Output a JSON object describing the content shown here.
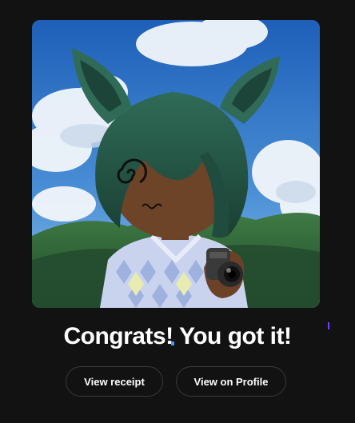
{
  "result": {
    "title": "Congrats! You got it!"
  },
  "artwork": {
    "icon": "nft-avatar-image"
  },
  "actions": {
    "receipt_label": "View receipt",
    "profile_label": "View on Profile"
  },
  "colors": {
    "background": "#121212",
    "button_border": "#3a3a3a",
    "text": "#ffffff"
  }
}
